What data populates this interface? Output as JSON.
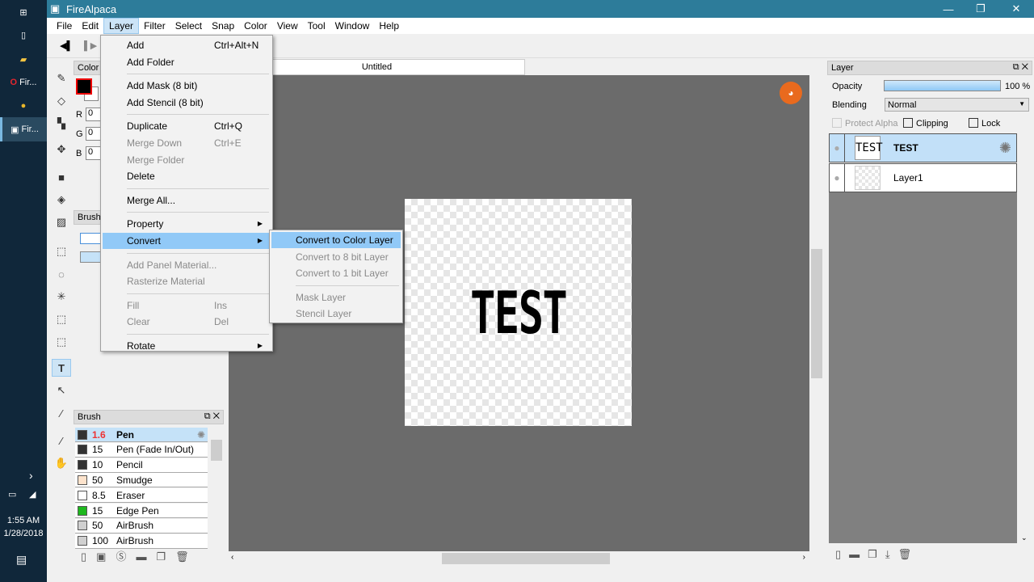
{
  "taskbar": {
    "items": [
      {
        "label": "Fir...",
        "icon": "opera-icon"
      },
      {
        "label": "",
        "icon": "chrome-icon"
      },
      {
        "label": "Fir...",
        "icon": "firealpaca-icon"
      }
    ],
    "time": "1:55 AM",
    "date": "1/28/2018"
  },
  "window": {
    "title": "FireAlpaca"
  },
  "menubar": [
    "File",
    "Edit",
    "Layer",
    "Filter",
    "Select",
    "Snap",
    "Color",
    "View",
    "Tool",
    "Window",
    "Help"
  ],
  "color_panel": {
    "title": "Color",
    "r": "0",
    "g": "0",
    "b": "0",
    "r_label": "R",
    "g_label": "G",
    "b_label": "B",
    "primary": "#000000",
    "secondary": "#ffffff"
  },
  "brush_mini": {
    "title": "Brush"
  },
  "document": {
    "tab": "Untitled",
    "text": "TEST"
  },
  "layer_menu": [
    {
      "label": "Add",
      "shortcut": "Ctrl+Alt+N"
    },
    {
      "label": "Add Folder"
    },
    {
      "sep": true
    },
    {
      "label": "Add Mask (8 bit)"
    },
    {
      "label": "Add Stencil (8 bit)"
    },
    {
      "sep": true
    },
    {
      "label": "Duplicate",
      "shortcut": "Ctrl+Q"
    },
    {
      "label": "Merge Down",
      "shortcut": "Ctrl+E",
      "disabled": true
    },
    {
      "label": "Merge Folder",
      "disabled": true
    },
    {
      "label": "Delete"
    },
    {
      "sep": true
    },
    {
      "label": "Merge All..."
    },
    {
      "sep": true
    },
    {
      "label": "Property",
      "submenu": true
    },
    {
      "label": "Convert",
      "submenu": true,
      "highlighted": true
    },
    {
      "sep": true
    },
    {
      "label": "Add Panel Material...",
      "disabled": true
    },
    {
      "label": "Rasterize Material",
      "disabled": true
    },
    {
      "sep": true
    },
    {
      "label": "Fill",
      "shortcut": "Ins",
      "disabled": true
    },
    {
      "label": "Clear",
      "shortcut": "Del",
      "disabled": true
    },
    {
      "sep": true
    },
    {
      "label": "Rotate",
      "submenu": true
    }
  ],
  "convert_menu": [
    {
      "label": "Convert to Color Layer",
      "highlighted": true
    },
    {
      "label": "Convert to 8 bit Layer",
      "disabled": true
    },
    {
      "label": "Convert to 1 bit Layer",
      "disabled": true
    },
    {
      "sep": true
    },
    {
      "label": "Mask Layer",
      "disabled": true
    },
    {
      "label": "Stencil Layer",
      "disabled": true
    }
  ],
  "brush_panel": {
    "title": "Brush",
    "items": [
      {
        "size": "1.6",
        "name": "Pen",
        "color": "#333333",
        "selected": true
      },
      {
        "size": "15",
        "name": "Pen (Fade In/Out)",
        "color": "#333333"
      },
      {
        "size": "10",
        "name": "Pencil",
        "color": "#333333"
      },
      {
        "size": "50",
        "name": "Smudge",
        "color": "#fde3cc"
      },
      {
        "size": "8.5",
        "name": "Eraser",
        "color": "#ffffff"
      },
      {
        "size": "15",
        "name": "Edge Pen",
        "color": "#1eb81e"
      },
      {
        "size": "50",
        "name": "AirBrush",
        "color": "#d0d0d0"
      },
      {
        "size": "100",
        "name": "AirBrush",
        "color": "#d0d0d0"
      }
    ]
  },
  "layer_panel": {
    "title": "Layer",
    "opacity_label": "Opacity",
    "opacity": "100 %",
    "opacity_value": 100,
    "blending_label": "Blending",
    "blending": "Normal",
    "protect_alpha": "Protect Alpha",
    "clipping": "Clipping",
    "lock": "Lock",
    "layers": [
      {
        "name": "TEST",
        "selected": true,
        "thumb": "TEST"
      },
      {
        "name": "Layer1"
      }
    ]
  }
}
